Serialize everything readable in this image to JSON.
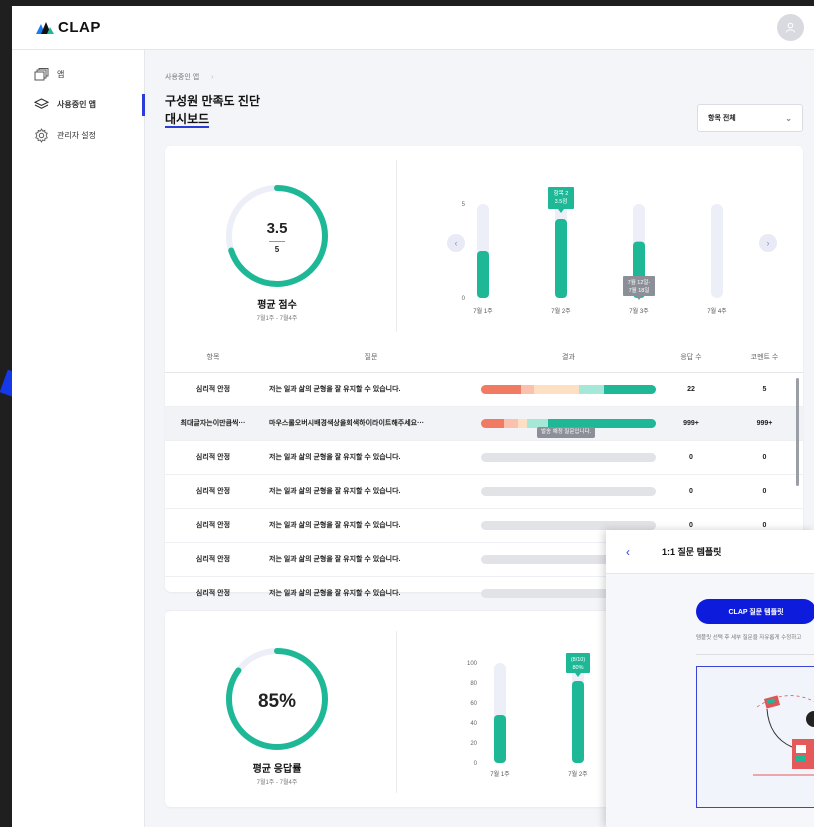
{
  "app": {
    "brand": "CLAP"
  },
  "sidebar": {
    "items": [
      {
        "label": "앱"
      },
      {
        "label": "사용중인 앱"
      },
      {
        "label": "관리자 설정"
      }
    ]
  },
  "breadcrumb": "사용중인 앱",
  "title": {
    "line1": "구성원 만족도 진단",
    "line2": "대시보드"
  },
  "filter": {
    "selected": "항목 전체"
  },
  "score_card": {
    "value": "3.5",
    "max": "5",
    "label": "평균 점수",
    "period": "7월1주 - 7월4주",
    "fill_fraction": 0.7
  },
  "score_chart": {
    "y_ticks": [
      "5",
      "0"
    ],
    "categories": [
      "7월 1주",
      "7월 2주",
      "7월 3주",
      "7월 4주"
    ],
    "values": [
      2.5,
      4.2,
      3.0,
      0
    ],
    "ylim": [
      0,
      5
    ],
    "tooltip_top": [
      "항목 2",
      "3.5점"
    ],
    "tooltip_bottom": [
      "7월 12일-",
      "7월 18일"
    ]
  },
  "table": {
    "headers": [
      "항목",
      "질문",
      "결과",
      "응답 수",
      "코멘트 수"
    ],
    "rows": [
      {
        "cat": "심리적 안정",
        "q": "저는 일과 삶의 균형을 잘 유지할 수 있습니다.",
        "resp": "22",
        "comm": "5"
      },
      {
        "cat": "최대글자는이만큼씩···",
        "q": "마우스롤오버시배경색상을회색하이라이트해주세요···",
        "resp": "999+",
        "comm": "999+"
      },
      {
        "cat": "심리적 안정",
        "q": "저는 일과 삶의 균형을 잘 유지할 수 있습니다.",
        "resp": "0",
        "comm": "0"
      },
      {
        "cat": "심리적 안정",
        "q": "저는 일과 삶의 균형을 잘 유지할 수 있습니다.",
        "resp": "0",
        "comm": "0"
      },
      {
        "cat": "심리적 안정",
        "q": "저는 일과 삶의 균형을 잘 유지할 수 있습니다.",
        "resp": "0",
        "comm": "0"
      },
      {
        "cat": "심리적 안정",
        "q": "저는 일과 삶의 균형을 잘 유지할 수 있습니다.",
        "resp": "",
        "comm": ""
      },
      {
        "cat": "심리적 안정",
        "q": "저는 일과 삶의 균형을 잘 유지할 수 있습니다.",
        "resp": "",
        "comm": ""
      }
    ],
    "pending_tooltip": "발송 예정 질문입니다."
  },
  "response_card": {
    "value": "85%",
    "label": "평균 응답률",
    "period": "7월1주 - 7월4주",
    "fill_fraction": 0.85
  },
  "response_chart": {
    "y_ticks": [
      "100",
      "80",
      "60",
      "40",
      "20",
      "0"
    ],
    "categories": [
      "7월 1주",
      "7월 2주"
    ],
    "values": [
      48,
      82
    ],
    "ylim": [
      0,
      100
    ],
    "tooltip": [
      "(8/10)",
      "80%"
    ]
  },
  "panel": {
    "title": "1:1 질문 템플릿",
    "button": "CLAP 질문 템플릿",
    "desc": "템플릿 선택 후 세부 질문을 자유롭게 수정하고"
  },
  "colors": {
    "accent": "#2a3cd9",
    "teal": "#1fb896",
    "button": "#0d1bdc",
    "track": "#eceef8"
  },
  "chart_data": [
    {
      "type": "bar",
      "categories": [
        "7월 1주",
        "7월 2주",
        "7월 3주",
        "7월 4주"
      ],
      "values": [
        2.5,
        4.2,
        3.0,
        0
      ],
      "ylim": [
        0,
        5
      ],
      "title": "",
      "xlabel": "",
      "ylabel": ""
    },
    {
      "type": "bar",
      "categories": [
        "7월 1주",
        "7월 2주"
      ],
      "values": [
        48,
        82
      ],
      "ylim": [
        0,
        100
      ],
      "title": "",
      "xlabel": "",
      "ylabel": ""
    }
  ]
}
